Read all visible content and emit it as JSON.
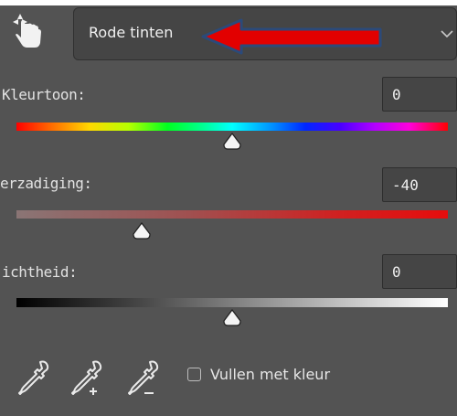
{
  "preset": {
    "selected": "Rode tinten",
    "chevron_icon": "chevron-down-icon"
  },
  "tool": {
    "icon": "targeted-adjustment-hand-icon"
  },
  "annotation": {
    "icon": "red-arrow-left-icon",
    "color": "#e20000",
    "outline": "#2b4a7a"
  },
  "sliders": [
    {
      "label": "Kleurtoon:",
      "value": "0",
      "level": 0.5
    },
    {
      "label": "Verzadiging:",
      "display_label": "erzadiging:",
      "value": "-40",
      "level": 0.3
    },
    {
      "label": "Lichtheid:",
      "display_label": "ichtheid:",
      "value": "0",
      "level": 0.5
    }
  ],
  "bottom": {
    "eyedroppers": [
      "eyedropper-icon",
      "eyedropper-add-icon",
      "eyedropper-subtract-icon"
    ],
    "checkbox_label": "Vullen met kleur",
    "checkbox_checked": false
  },
  "colors": {
    "panel_bg": "#535353",
    "field_bg": "#454545",
    "text": "#e6e6e6"
  }
}
